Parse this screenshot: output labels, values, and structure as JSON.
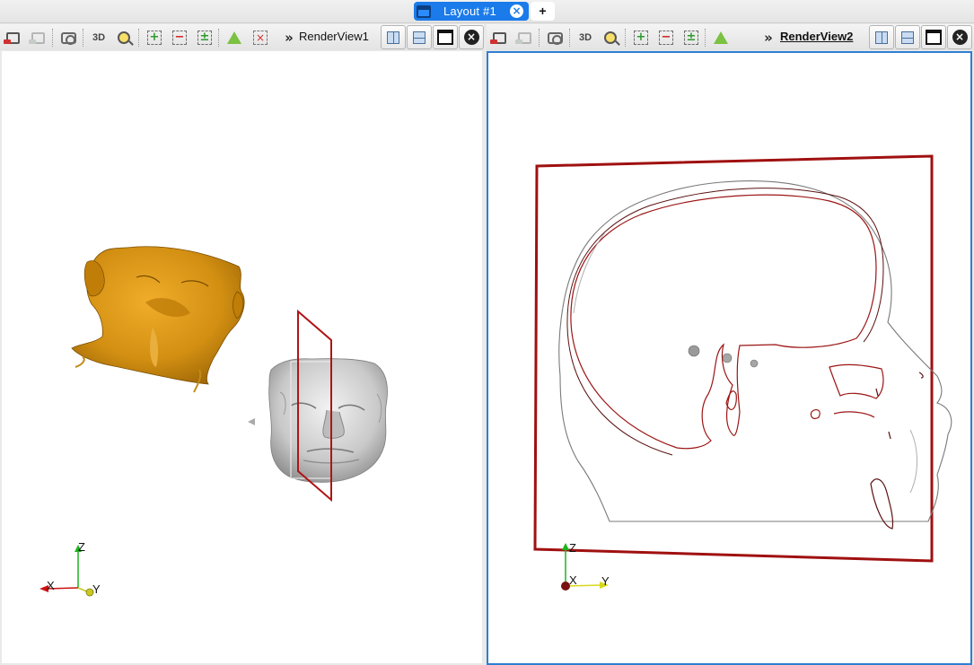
{
  "tabs": [
    {
      "label": "Layout #1",
      "close": "×"
    }
  ],
  "add_tab_label": "+",
  "views": [
    {
      "name": "RenderView1",
      "toolbar_3d_label": "3D",
      "more": "»",
      "axes": {
        "x": "X",
        "y": "Y",
        "z": "Z"
      }
    },
    {
      "name": "RenderView2",
      "toolbar_3d_label": "3D",
      "more": "»",
      "axes": {
        "x": "X",
        "y": "Y",
        "z": "Z"
      }
    }
  ],
  "icons": {
    "split_horizontal": "split-horizontal-icon",
    "split_vertical": "split-vertical-icon",
    "maximize": "maximize-icon",
    "close": "close-icon"
  },
  "colors": {
    "accent": "#1b7bea",
    "active_view_border": "#2f7fd1",
    "skin_surface": "#d28f12",
    "bone_surface": "#c8c8c8",
    "slice_outline": "#b01414"
  }
}
